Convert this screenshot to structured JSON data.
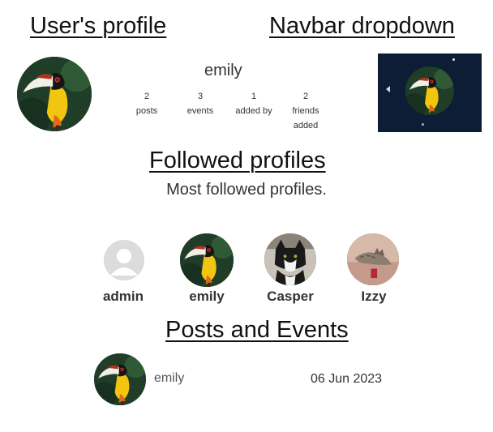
{
  "headings": {
    "user_profile": "User's profile",
    "navbar_dropdown": "Navbar dropdown",
    "followed_profiles": "Followed profiles",
    "posts_events": "Posts and Events"
  },
  "profile": {
    "username": "emily",
    "stats": [
      {
        "value": "2",
        "label": "posts"
      },
      {
        "value": "3",
        "label": "events"
      },
      {
        "value": "1",
        "label": "added by"
      },
      {
        "value": "2",
        "label": "friends added"
      }
    ]
  },
  "followed": {
    "subtitle": "Most followed profiles.",
    "users": [
      {
        "name": "admin",
        "avatar": "default-user-icon"
      },
      {
        "name": "emily",
        "avatar": "toucan-photo"
      },
      {
        "name": "Casper",
        "avatar": "cat-photo"
      },
      {
        "name": "Izzy",
        "avatar": "cat-photo"
      }
    ]
  },
  "post": {
    "author": "emily",
    "date": "06 Jun 2023"
  },
  "colors": {
    "navbar_bg": "#0c1d35",
    "heading_text": "#111111"
  }
}
